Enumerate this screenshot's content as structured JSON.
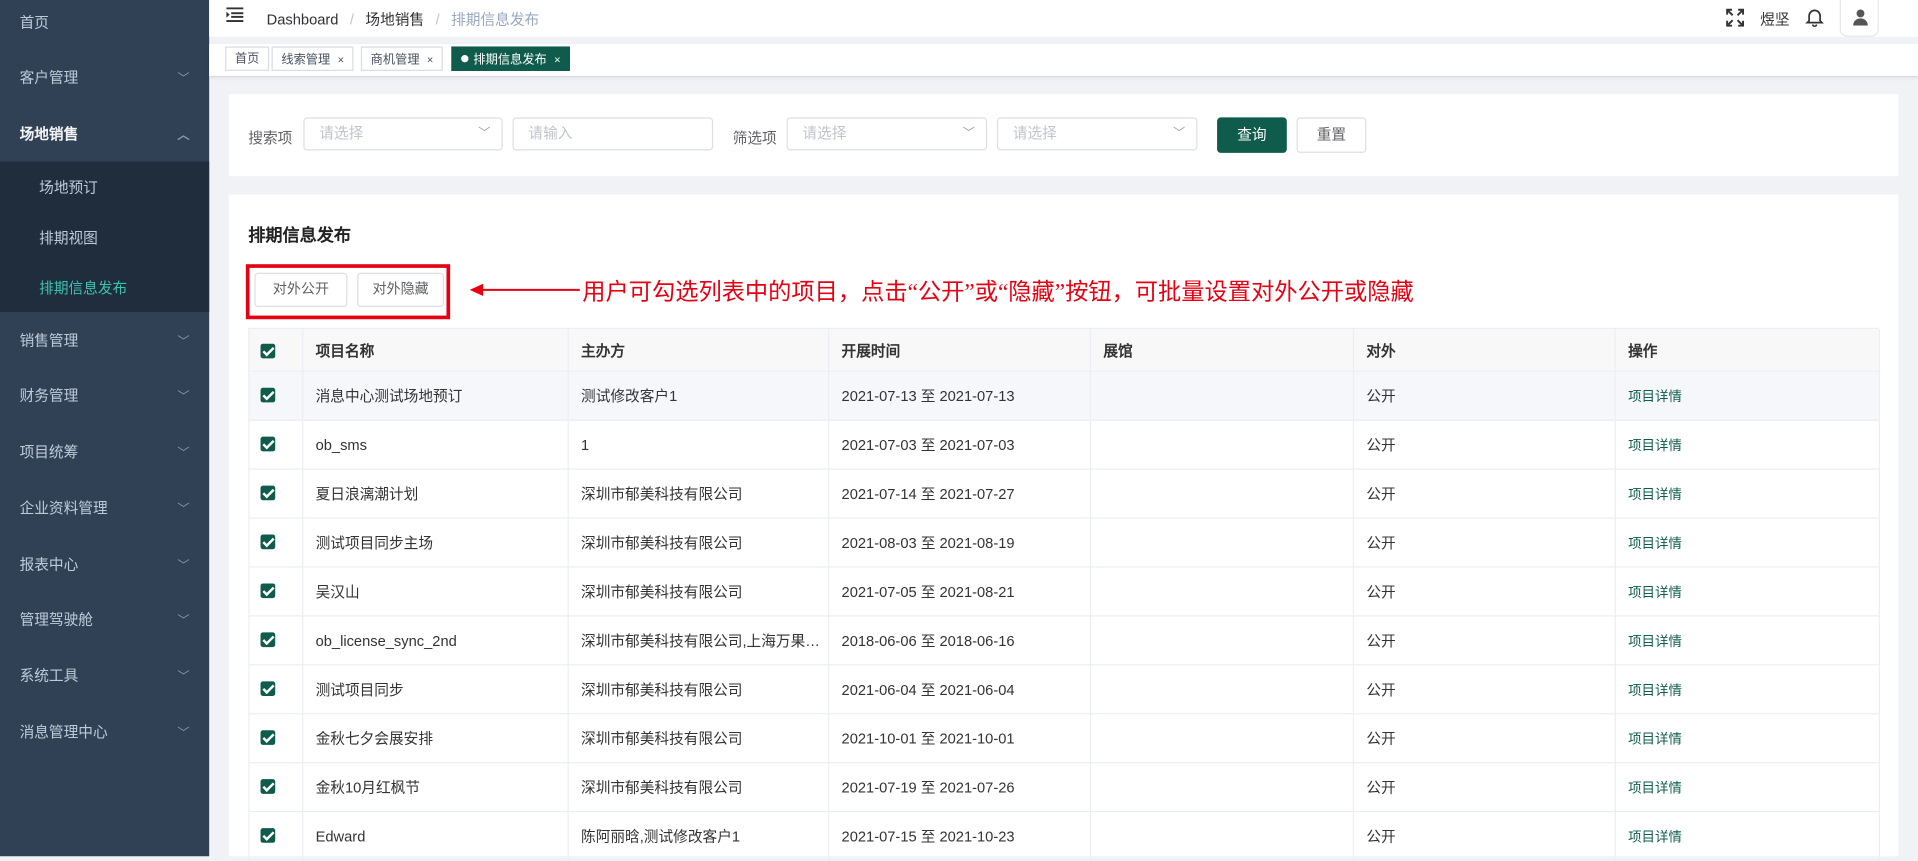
{
  "sidebar": {
    "items": [
      {
        "label": "首页"
      },
      {
        "label": "客户管理"
      },
      {
        "label": "场地销售"
      },
      {
        "label": "销售管理"
      },
      {
        "label": "财务管理"
      },
      {
        "label": "项目统筹"
      },
      {
        "label": "企业资料管理"
      },
      {
        "label": "报表中心"
      },
      {
        "label": "管理驾驶舱"
      },
      {
        "label": "系统工具"
      },
      {
        "label": "消息管理中心"
      }
    ],
    "sub_items": [
      {
        "label": "场地预订"
      },
      {
        "label": "排期视图"
      },
      {
        "label": "排期信息发布"
      }
    ]
  },
  "breadcrumb": {
    "items": [
      "Dashboard",
      "场地销售",
      "排期信息发布"
    ],
    "separator": "/"
  },
  "navbar": {
    "username": "煜坚"
  },
  "tags": [
    {
      "label": "首页",
      "closable": false
    },
    {
      "label": "线索管理",
      "closable": true
    },
    {
      "label": "商机管理",
      "closable": true
    },
    {
      "label": "排期信息发布",
      "closable": true,
      "active": true
    }
  ],
  "search": {
    "search_label": "搜索项",
    "search_select_placeholder": "请选择",
    "search_input_placeholder": "请输入",
    "filter_label": "筛选项",
    "filter_select1_placeholder": "请选择",
    "filter_select2_placeholder": "请选择",
    "query_button": "查询",
    "reset_button": "重置"
  },
  "main": {
    "title": "排期信息发布",
    "public_button": "对外公开",
    "hide_button": "对外隐藏",
    "annotation": "用户可勾选列表中的项目，点击“公开”或“隐藏”按钮，可批量设置对外公开或隐藏"
  },
  "table": {
    "columns": [
      "项目名称",
      "主办方",
      "开展时间",
      "展馆",
      "对外",
      "操作"
    ],
    "rows": [
      {
        "name": "消息中心测试场地预订",
        "organizer": "测试修改客户1",
        "time": "2021-07-13 至 2021-07-13",
        "hall": "",
        "external": "公开",
        "action": "项目详情"
      },
      {
        "name": "ob_sms",
        "organizer": "1",
        "time": "2021-07-03 至 2021-07-03",
        "hall": "",
        "external": "公开",
        "action": "项目详情"
      },
      {
        "name": "夏日浪漓潮计划",
        "organizer": "深圳市郁美科技有限公司",
        "time": "2021-07-14 至 2021-07-27",
        "hall": "",
        "external": "公开",
        "action": "项目详情"
      },
      {
        "name": "测试项目同步主场",
        "organizer": "深圳市郁美科技有限公司",
        "time": "2021-08-03 至 2021-08-19",
        "hall": "",
        "external": "公开",
        "action": "项目详情"
      },
      {
        "name": "吴汉山",
        "organizer": "深圳市郁美科技有限公司",
        "time": "2021-07-05 至 2021-08-21",
        "hall": "",
        "external": "公开",
        "action": "项目详情"
      },
      {
        "name": "ob_license_sync_2nd",
        "organizer": "深圳市郁美科技有限公司,上海万果…",
        "time": "2018-06-06 至 2018-06-16",
        "hall": "",
        "external": "公开",
        "action": "项目详情"
      },
      {
        "name": "测试项目同步",
        "organizer": "深圳市郁美科技有限公司",
        "time": "2021-06-04 至 2021-06-04",
        "hall": "",
        "external": "公开",
        "action": "项目详情"
      },
      {
        "name": "金秋七夕会展安排",
        "organizer": "深圳市郁美科技有限公司",
        "time": "2021-10-01 至 2021-10-01",
        "hall": "",
        "external": "公开",
        "action": "项目详情"
      },
      {
        "name": "金秋10月红枫节",
        "organizer": "深圳市郁美科技有限公司",
        "time": "2021-07-19 至 2021-07-26",
        "hall": "",
        "external": "公开",
        "action": "项目详情"
      },
      {
        "name": "Edward",
        "organizer": "陈阿丽晗,测试修改客户1",
        "time": "2021-07-15 至 2021-10-23",
        "hall": "",
        "external": "公开",
        "action": "项目详情"
      }
    ]
  },
  "colors": {
    "sidebar_bg": "#304156",
    "accent": "#0f5c4d",
    "annotation_red": "#e60012"
  }
}
